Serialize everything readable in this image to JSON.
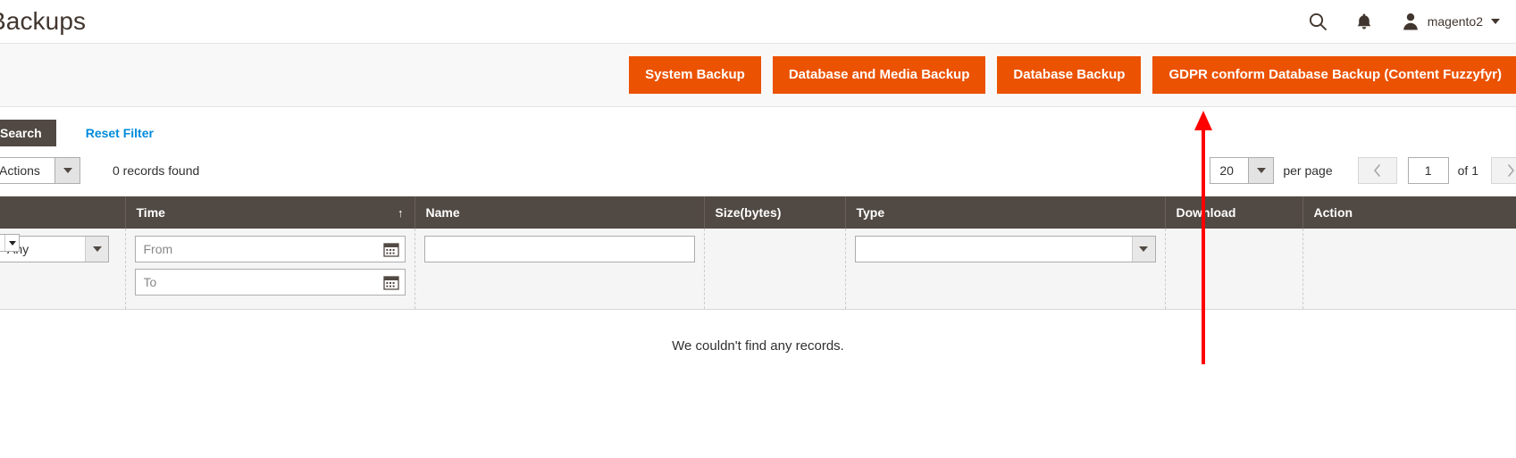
{
  "header": {
    "title": "Backups",
    "search_icon": "search-icon",
    "notifications_icon": "bell-icon",
    "user": {
      "avatar_icon": "user-avatar-icon",
      "name": "magento2",
      "caret_icon": "chevron-down-icon"
    }
  },
  "actions_bar": {
    "buttons": [
      {
        "label": "System Backup",
        "name": "system-backup-button"
      },
      {
        "label": "Database and Media Backup",
        "name": "database-and-media-backup-button"
      },
      {
        "label": "Database Backup",
        "name": "database-backup-button"
      },
      {
        "label": "GDPR conform Database Backup (Content Fuzzyfyr)",
        "name": "gdpr-conform-database-backup-button"
      }
    ],
    "accent_color": "#eb5202"
  },
  "filter_bar": {
    "search_label": "Search",
    "reset_filter_label": "Reset Filter",
    "link_color": "#008bdb"
  },
  "controls": {
    "actions_label": "Actions",
    "records_found": "0 records found",
    "per_page_value": "20",
    "per_page_label": "per page",
    "prev_icon": "chevron-left-icon",
    "next_icon": "chevron-right-icon",
    "page_value": "1",
    "of_label": "of 1"
  },
  "grid": {
    "columns": [
      {
        "label": "",
        "name": "select-all-column"
      },
      {
        "label": "Time",
        "name": "time-column",
        "sort": "↑"
      },
      {
        "label": "Name",
        "name": "name-column"
      },
      {
        "label": "Size(bytes)",
        "name": "size-bytes-column"
      },
      {
        "label": "Type",
        "name": "type-column"
      },
      {
        "label": "Download",
        "name": "download-column"
      },
      {
        "label": "Action",
        "name": "action-column"
      }
    ],
    "filters": {
      "massaction_value": "Any",
      "time_from_placeholder": "From",
      "time_to_placeholder": "To",
      "time_from_value": "",
      "time_to_value": "",
      "name_value": "",
      "type_value": ""
    },
    "empty_message": "We couldn't find any records.",
    "header_color": "#514943"
  },
  "annotation": {
    "color": "#ff0000",
    "name": "red-arrow-annotation"
  }
}
